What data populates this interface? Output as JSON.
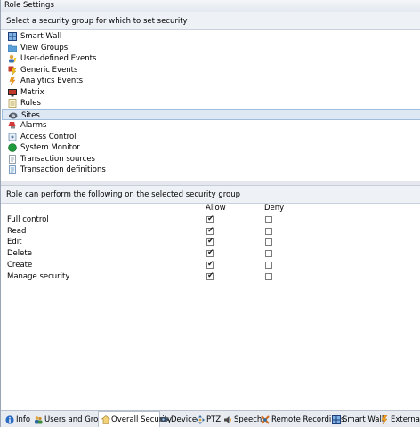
{
  "window": {
    "title": "Role Settings"
  },
  "security_group_panel": {
    "prompt": "Select a security group for which to set security",
    "items": [
      {
        "label": "Smart Wall",
        "icon": "smart-wall-icon",
        "selected": false
      },
      {
        "label": "View Groups",
        "icon": "folder-icon",
        "selected": false
      },
      {
        "label": "User-defined Events",
        "icon": "user-defined-events-icon",
        "selected": false
      },
      {
        "label": "Generic Events",
        "icon": "generic-events-icon",
        "selected": false
      },
      {
        "label": "Analytics Events",
        "icon": "analytics-events-icon",
        "selected": false
      },
      {
        "label": "Matrix",
        "icon": "matrix-icon",
        "selected": false
      },
      {
        "label": "Rules",
        "icon": "rules-icon",
        "selected": false
      },
      {
        "label": "Sites",
        "icon": "sites-icon",
        "selected": true
      },
      {
        "label": "Alarms",
        "icon": "alarms-icon",
        "selected": false
      },
      {
        "label": "Access Control",
        "icon": "access-control-icon",
        "selected": false
      },
      {
        "label": "System Monitor",
        "icon": "system-monitor-icon",
        "selected": false
      },
      {
        "label": "Transaction sources",
        "icon": "transaction-sources-icon",
        "selected": false
      },
      {
        "label": "Transaction definitions",
        "icon": "transaction-definitions-icon",
        "selected": false
      }
    ]
  },
  "permissions_panel": {
    "prompt": "Role can perform the following on the selected security group",
    "allow_header": "Allow",
    "deny_header": "Deny",
    "rows": [
      {
        "label": "Full control",
        "allow": true,
        "deny": false
      },
      {
        "label": "Read",
        "allow": true,
        "deny": false
      },
      {
        "label": "Edit",
        "allow": true,
        "deny": false
      },
      {
        "label": "Delete",
        "allow": true,
        "deny": false
      },
      {
        "label": "Create",
        "allow": true,
        "deny": false
      },
      {
        "label": "Manage security",
        "allow": true,
        "deny": false
      }
    ]
  },
  "tabs": [
    {
      "label": "Info",
      "icon": "info-icon",
      "active": false
    },
    {
      "label": "Users and Groups",
      "icon": "users-groups-icon",
      "active": false
    },
    {
      "label": "Overall Security",
      "icon": "overall-security-icon",
      "active": true
    },
    {
      "label": "Device",
      "icon": "device-icon",
      "active": false
    },
    {
      "label": "PTZ",
      "icon": "ptz-icon",
      "active": false
    },
    {
      "label": "Speech",
      "icon": "speech-icon",
      "active": false
    },
    {
      "label": "Remote Recordings",
      "icon": "remote-recordings-icon",
      "active": false
    },
    {
      "label": "Smart Wall",
      "icon": "smart-wall-icon",
      "active": false
    },
    {
      "label": "External Ev",
      "icon": "external-events-icon",
      "active": false
    }
  ],
  "colors": {
    "selection_bg": "#dde8f4",
    "selection_border": "#9fbddd",
    "panel_header_bg": "#eef1f5"
  }
}
